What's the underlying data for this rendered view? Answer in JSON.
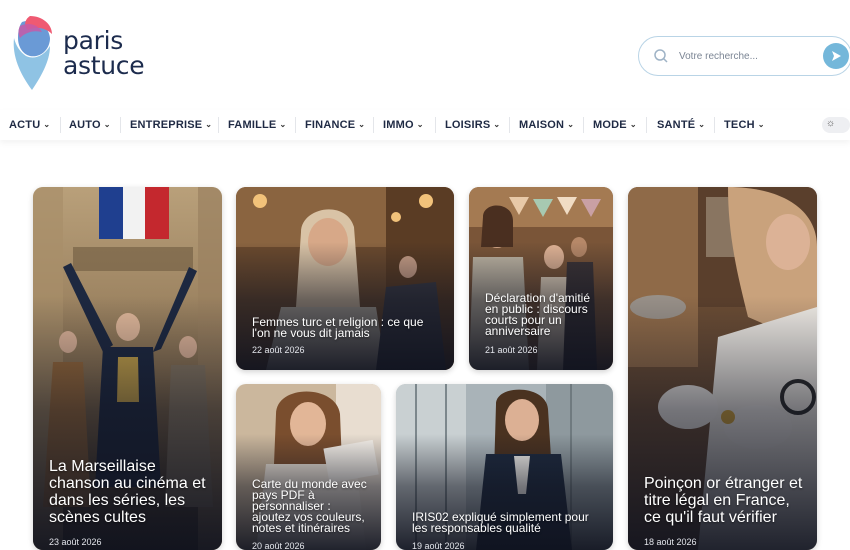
{
  "brand": {
    "line1": "paris",
    "line2": "astuce"
  },
  "search": {
    "placeholder": "Votre recherche..."
  },
  "nav": [
    {
      "label": "ACTU"
    },
    {
      "label": "AUTO"
    },
    {
      "label": "ENTREPRISE"
    },
    {
      "label": "FAMILLE"
    },
    {
      "label": "FINANCE"
    },
    {
      "label": "IMMO"
    },
    {
      "label": "LOISIRS"
    },
    {
      "label": "MAISON"
    },
    {
      "label": "MODE"
    },
    {
      "label": "SANTÉ"
    },
    {
      "label": "TECH"
    }
  ],
  "articles": [
    {
      "title": "La Marseillaise chanson au cinéma et dans les séries, les scènes cultes",
      "date": "23 août 2026"
    },
    {
      "title": "Femmes turc et religion : ce que l'on ne vous dit jamais",
      "date": "22 août 2026"
    },
    {
      "title": "Déclaration d'amitié en public : discours courts pour un anniversaire",
      "date": "21 août 2026"
    },
    {
      "title": "Poinçon or étranger et titre légal en France, ce qu'il faut vérifier",
      "date": "18 août 2026"
    },
    {
      "title": "Carte du monde avec pays PDF à personnaliser : ajoutez vos couleurs, notes et itinéraires",
      "date": "20 août 2026"
    },
    {
      "title": "IRIS02 expliqué simplement pour les responsables qualité",
      "date": "19 août 2026"
    }
  ],
  "colors": {
    "accent": "#74b7da",
    "text": "#1f2a44"
  }
}
